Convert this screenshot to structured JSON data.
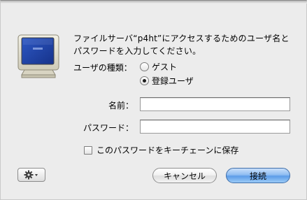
{
  "dialog": {
    "prompt": "ファイルサーバ“p4ht”にアクセスするためのユーザ名とパスワードを入力してください。",
    "user_type_label": "ユーザの種類：",
    "user_type_options": [
      {
        "label": "ゲスト",
        "selected": false
      },
      {
        "label": "登録ユーザ",
        "selected": true
      }
    ],
    "name_label": "名前：",
    "name_value": "",
    "password_label": "パスワード：",
    "password_value": "",
    "keychain_label": "このパスワードをキーチェーンに保存",
    "keychain_checked": false,
    "cancel_label": "キャンセル",
    "connect_label": "接続"
  },
  "icons": {
    "monitor": "monitor-icon",
    "gear": "gear-icon"
  },
  "colors": {
    "default_button": "#5c9ce8",
    "screen": "#2a4fb0"
  }
}
